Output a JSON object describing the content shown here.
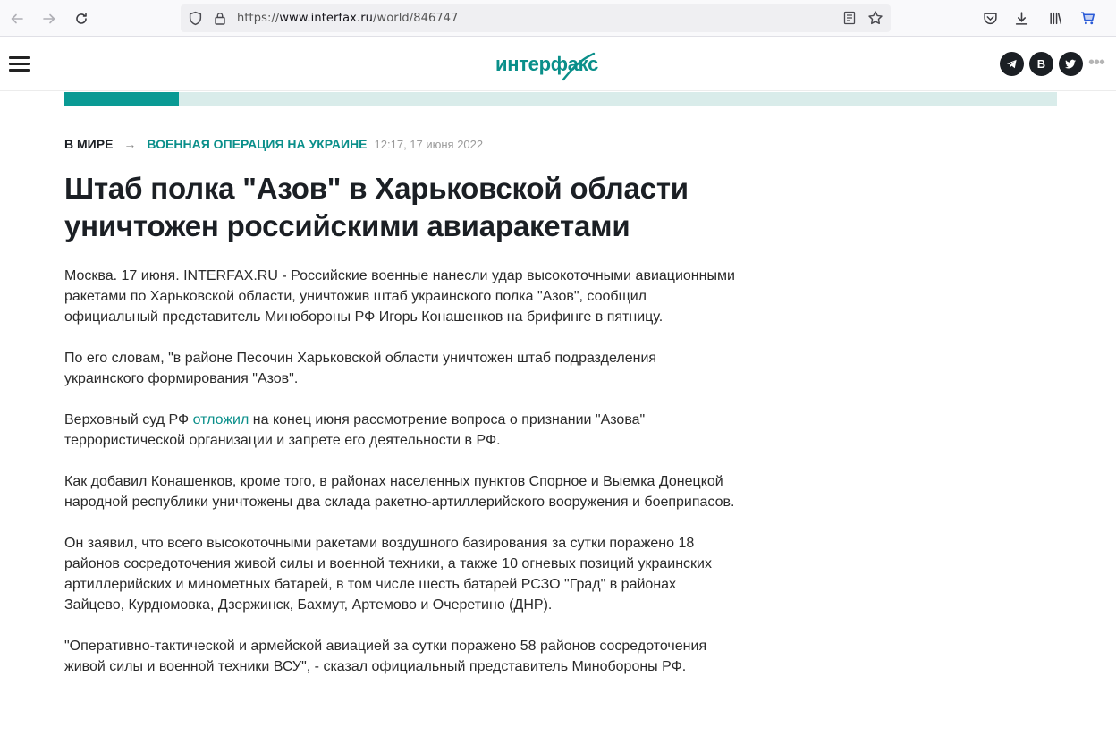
{
  "browser": {
    "url_scheme": "https://",
    "url_host": "www.interfax.ru",
    "url_path": "/world/846747"
  },
  "header": {
    "logo_text": "интерфакс",
    "social": [
      {
        "name": "telegram-icon"
      },
      {
        "name": "vk-icon",
        "glyph": "В"
      },
      {
        "name": "twitter-icon"
      }
    ],
    "more_glyph": "•••"
  },
  "reading_progress": 0.115,
  "breadcrumbs": {
    "section": "В МИРЕ",
    "arrow": "→",
    "topic": "ВОЕННАЯ ОПЕРАЦИЯ НА УКРАИНЕ",
    "timestamp": "12:17, 17 июня 2022"
  },
  "article": {
    "headline_line1": "Штаб полка \"Азов\" в Харьковской области",
    "headline_line2": "уничтожен российскими авиаракетами",
    "p1": "Москва. 17 июня. INTERFAX.RU - Российские военные нанесли удар высокоточными авиационными ракетами по Харьковской области, уничтожив штаб украинского полка \"Азов\", сообщил официальный представитель Минобороны РФ Игорь Конашенков на брифинге в пятницу.",
    "p2": "По его словам, \"в районе Песочин Харьковской области уничтожен штаб подразделения украинского формирования \"Азов\".",
    "p3_before": "Верховный суд РФ ",
    "p3_link": "отложил",
    "p3_after": " на конец июня рассмотрение вопроса о признании \"Азова\" террористической организации и запрете его деятельности в РФ.",
    "p4": "Как добавил Конашенков, кроме того, в районах населенных пунктов Спорное и Выемка Донецкой народной республики уничтожены два склада ракетно-артиллерийского вооружения и боеприпасов.",
    "p5": "Он заявил, что всего высокоточными ракетами воздушного базирования за сутки поражено 18 районов сосредоточения живой силы и военной техники, а также 10 огневых позиций украинских артиллерийских и минометных батарей, в том числе шесть батарей РСЗО \"Град\" в районах Зайцево, Курдюмовка, Дзержинск, Бахмут, Артемово и Очеретино (ДНР).",
    "p6": "\"Оперативно-тактической и армейской авиацией за сутки поражено 58 районов сосредоточения живой силы и военной техники ВСУ\", - сказал официальный представитель Минобороны РФ."
  },
  "colors": {
    "brand_teal": "#0a8f8a",
    "progress_fill": "#0a9a94",
    "progress_track": "#d9ecea",
    "text_dark": "#1b1f24"
  }
}
